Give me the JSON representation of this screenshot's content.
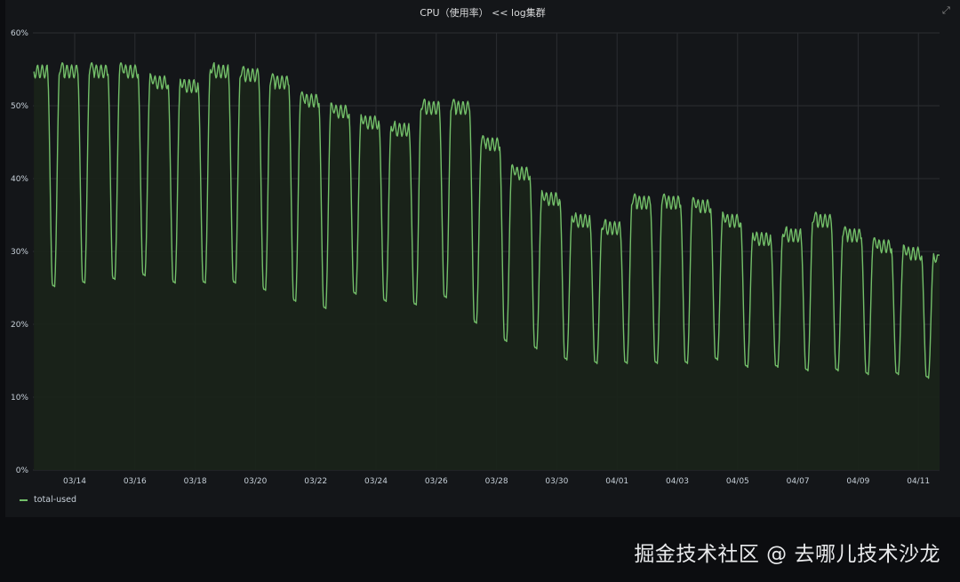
{
  "panel": {
    "title": "CPU（使用率） << log集群",
    "icon": "expand-icon"
  },
  "legend": {
    "label": "total-used",
    "color": "#73bf69"
  },
  "watermark": "掘金技术社区 @ 去哪儿技术沙龙",
  "colors": {
    "line": "#73bf69",
    "fill": "#1a2419",
    "grid": "#2b2d31",
    "background": "#141619"
  },
  "chart_data": {
    "type": "area",
    "title": "CPU（使用率） << log集群",
    "series": [
      {
        "name": "total-used"
      }
    ],
    "y_ticks": [
      "0%",
      "10%",
      "20%",
      "30%",
      "40%",
      "50%",
      "60%"
    ],
    "ylim": [
      0,
      60
    ],
    "x_ticks": [
      "03/14",
      "03/16",
      "03/18",
      "03/20",
      "03/22",
      "03/24",
      "03/26",
      "03/28",
      "03/30",
      "04/01",
      "04/03",
      "04/05",
      "04/07",
      "04/09",
      "04/11"
    ],
    "grid": true,
    "daily": [
      {
        "day": 0,
        "high": 55.5,
        "low": 25
      },
      {
        "day": 1,
        "high": 55.5,
        "low": 25.5
      },
      {
        "day": 2,
        "high": 55.5,
        "low": 26
      },
      {
        "day": 3,
        "high": 55.5,
        "low": 26.5
      },
      {
        "day": 4,
        "high": 54,
        "low": 25.5
      },
      {
        "day": 5,
        "high": 53.5,
        "low": 25.5
      },
      {
        "day": 6,
        "high": 55.5,
        "low": 25.5
      },
      {
        "day": 7,
        "high": 55,
        "low": 24.5
      },
      {
        "day": 8,
        "high": 54,
        "low": 23
      },
      {
        "day": 9,
        "high": 51.5,
        "low": 22
      },
      {
        "day": 10,
        "high": 50,
        "low": 24
      },
      {
        "day": 11,
        "high": 48.5,
        "low": 23
      },
      {
        "day": 12,
        "high": 47.5,
        "low": 22.5
      },
      {
        "day": 13,
        "high": 50.5,
        "low": 23.5
      },
      {
        "day": 14,
        "high": 50.5,
        "low": 20
      },
      {
        "day": 15,
        "high": 45.5,
        "low": 17.5
      },
      {
        "day": 16,
        "high": 41.5,
        "low": 16.5
      },
      {
        "day": 17,
        "high": 38,
        "low": 15
      },
      {
        "day": 18,
        "high": 35,
        "low": 14.5
      },
      {
        "day": 19,
        "high": 34,
        "low": 14.5
      },
      {
        "day": 20,
        "high": 37.5,
        "low": 14.5
      },
      {
        "day": 21,
        "high": 37.5,
        "low": 14.5
      },
      {
        "day": 22,
        "high": 37,
        "low": 15
      },
      {
        "day": 23,
        "high": 35,
        "low": 14
      },
      {
        "day": 24,
        "high": 32.5,
        "low": 14
      },
      {
        "day": 25,
        "high": 33,
        "low": 13.5
      },
      {
        "day": 26,
        "high": 35,
        "low": 13.5
      },
      {
        "day": 27,
        "high": 33,
        "low": 13
      },
      {
        "day": 28,
        "high": 31.5,
        "low": 13
      },
      {
        "day": 29,
        "high": 30.5,
        "low": 12.5
      },
      {
        "day": 30,
        "high": 29.5,
        "low": 29.5
      }
    ]
  }
}
